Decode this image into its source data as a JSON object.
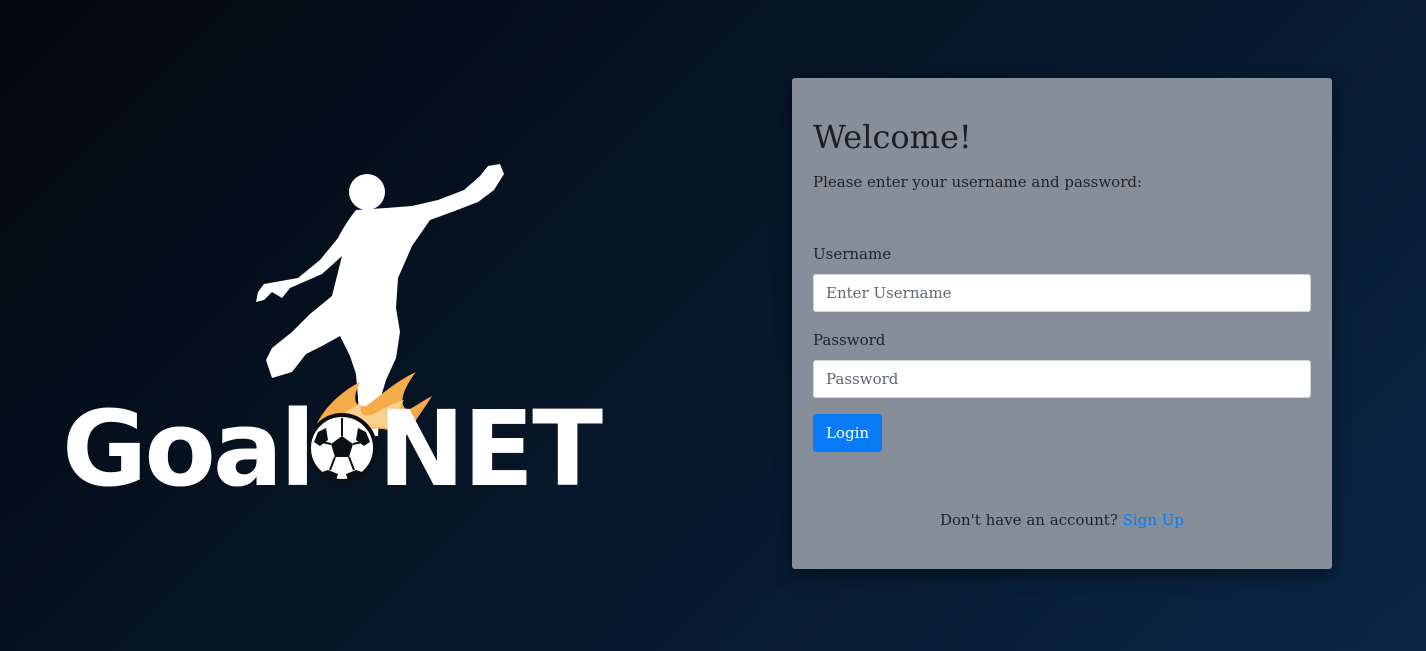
{
  "brand": {
    "logo_text": "GoalNET",
    "logo_alt": "Player kicking ball logo",
    "flame_color": "#f6ab4a"
  },
  "login": {
    "title": "Welcome!",
    "subtitle": "Please enter your username and password:",
    "username_label": "Username",
    "username_placeholder": "Enter Username",
    "username_value": "",
    "password_label": "Password",
    "password_placeholder": "Password",
    "password_value": "",
    "login_button": "Login",
    "signup_prompt": "Don't have an account?",
    "signup_link": "Sign Up"
  },
  "colors": {
    "accent": "#0a7bf7",
    "card_background": "#868e99",
    "page_background_start": "#03080f",
    "page_background_end": "#0b2646"
  }
}
